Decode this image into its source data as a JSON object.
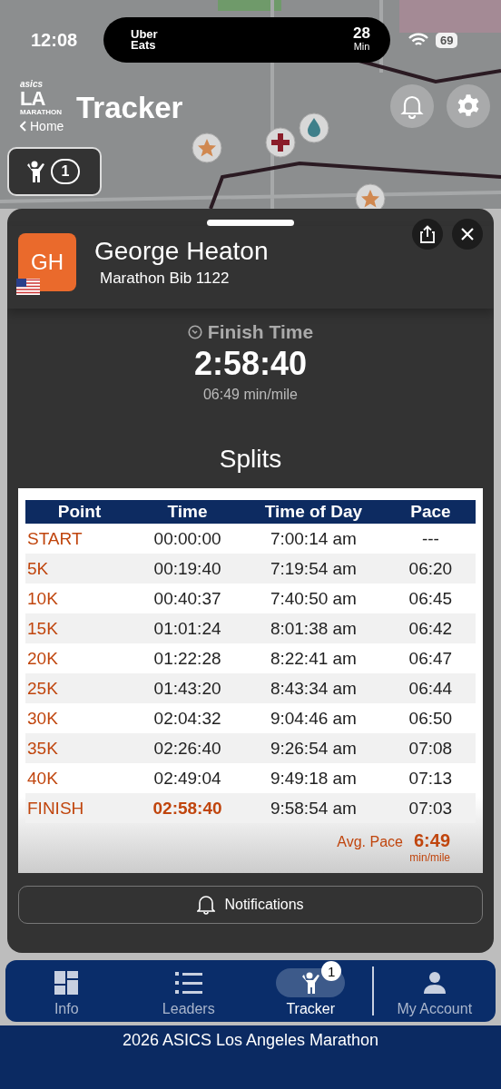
{
  "status_bar": {
    "time": "12:08",
    "live_activity": {
      "brand_line_1": "Uber",
      "brand_line_2": "Eats",
      "value": "28",
      "unit": "Min"
    },
    "battery": "69"
  },
  "header": {
    "logo": {
      "brand": "asics",
      "city": "LA",
      "event": "MARATHON"
    },
    "title": "Tracker",
    "back_link": "Home",
    "tracked_count": "1"
  },
  "runner": {
    "initials": "GH",
    "name": "George Heaton",
    "bib": "Marathon Bib 1122"
  },
  "finish": {
    "label": "Finish Time",
    "time": "2:58:40",
    "pace": "06:49 min/mile"
  },
  "splits": {
    "title": "Splits",
    "columns": [
      "Point",
      "Time",
      "Time of Day",
      "Pace"
    ],
    "rows": [
      {
        "point": "START",
        "time": "00:00:00",
        "time_of_day": "7:00:14 am",
        "pace": "---",
        "highlight": false
      },
      {
        "point": "5K",
        "time": "00:19:40",
        "time_of_day": "7:19:54 am",
        "pace": "06:20",
        "highlight": false
      },
      {
        "point": "10K",
        "time": "00:40:37",
        "time_of_day": "7:40:50 am",
        "pace": "06:45",
        "highlight": false
      },
      {
        "point": "15K",
        "time": "01:01:24",
        "time_of_day": "8:01:38 am",
        "pace": "06:42",
        "highlight": false
      },
      {
        "point": "20K",
        "time": "01:22:28",
        "time_of_day": "8:22:41 am",
        "pace": "06:47",
        "highlight": false
      },
      {
        "point": "25K",
        "time": "01:43:20",
        "time_of_day": "8:43:34 am",
        "pace": "06:44",
        "highlight": false
      },
      {
        "point": "30K",
        "time": "02:04:32",
        "time_of_day": "9:04:46 am",
        "pace": "06:50",
        "highlight": false
      },
      {
        "point": "35K",
        "time": "02:26:40",
        "time_of_day": "9:26:54 am",
        "pace": "07:08",
        "highlight": false
      },
      {
        "point": "40K",
        "time": "02:49:04",
        "time_of_day": "9:49:18 am",
        "pace": "07:13",
        "highlight": false
      },
      {
        "point": "FINISH",
        "time": "02:58:40",
        "time_of_day": "9:58:54 am",
        "pace": "07:03",
        "highlight": true
      }
    ],
    "avg_pace": {
      "label": "Avg. Pace",
      "value": "6:49",
      "unit": "min/mile"
    }
  },
  "notifications_button": "Notifications",
  "tabs": [
    {
      "label": "Info",
      "selected": false
    },
    {
      "label": "Leaders",
      "selected": false
    },
    {
      "label": "Tracker",
      "selected": true,
      "badge": "1"
    },
    {
      "label": "My Account",
      "selected": false
    }
  ],
  "footer": "2026 ASICS Los Angeles Marathon"
}
